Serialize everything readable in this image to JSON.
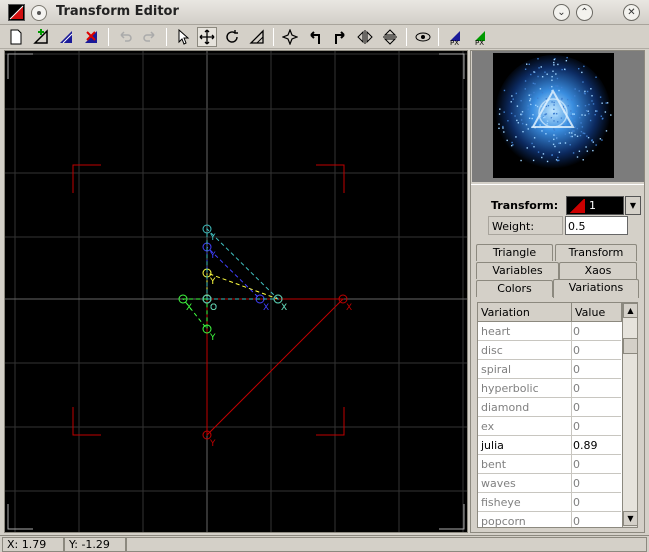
{
  "window": {
    "title": "Transform Editor"
  },
  "toolbar": {
    "icons": [
      "new-icon",
      "add-transform-icon",
      "duplicate-transform-icon",
      "delete-transform-icon",
      "undo-icon",
      "redo-icon",
      "select-icon",
      "move-icon",
      "rotate-icon",
      "scale-icon",
      "flip-center-icon",
      "rotate-left-icon",
      "rotate-right-icon",
      "flip-horizontal-icon",
      "flip-vertical-icon",
      "preview-icon",
      "post-transform-icon",
      "post-transform-alt-icon"
    ]
  },
  "colors": {
    "canvas_bg": "#000000",
    "grid": "#333333",
    "axis": "#666666",
    "transform_main": "#c00000",
    "transform_a": "#4040ff",
    "transform_b": "#ffff40",
    "transform_c": "#40ff40",
    "transform_d": "#40c0c0"
  },
  "editor": {
    "point_labels": {
      "x": "X",
      "y": "Y",
      "o": "O"
    }
  },
  "panel": {
    "transform_label": "Transform:",
    "transform_value": "1",
    "weight_label": "Weight:",
    "weight_value": "0.5",
    "tabs": {
      "triangle": "Triangle",
      "transform": "Transform",
      "variables": "Variables",
      "xaos": "Xaos",
      "colors": "Colors",
      "variations": "Variations"
    },
    "grid_headers": {
      "name": "Variation",
      "value": "Value"
    },
    "variations": [
      {
        "name": "heart",
        "value": "0"
      },
      {
        "name": "disc",
        "value": "0"
      },
      {
        "name": "spiral",
        "value": "0"
      },
      {
        "name": "hyperbolic",
        "value": "0"
      },
      {
        "name": "diamond",
        "value": "0"
      },
      {
        "name": "ex",
        "value": "0"
      },
      {
        "name": "julia",
        "value": "0.89"
      },
      {
        "name": "bent",
        "value": "0"
      },
      {
        "name": "waves",
        "value": "0"
      },
      {
        "name": "fisheye",
        "value": "0"
      },
      {
        "name": "popcorn",
        "value": "0"
      }
    ]
  },
  "status": {
    "x": "X: 1.79",
    "y": "Y: -1.29"
  }
}
